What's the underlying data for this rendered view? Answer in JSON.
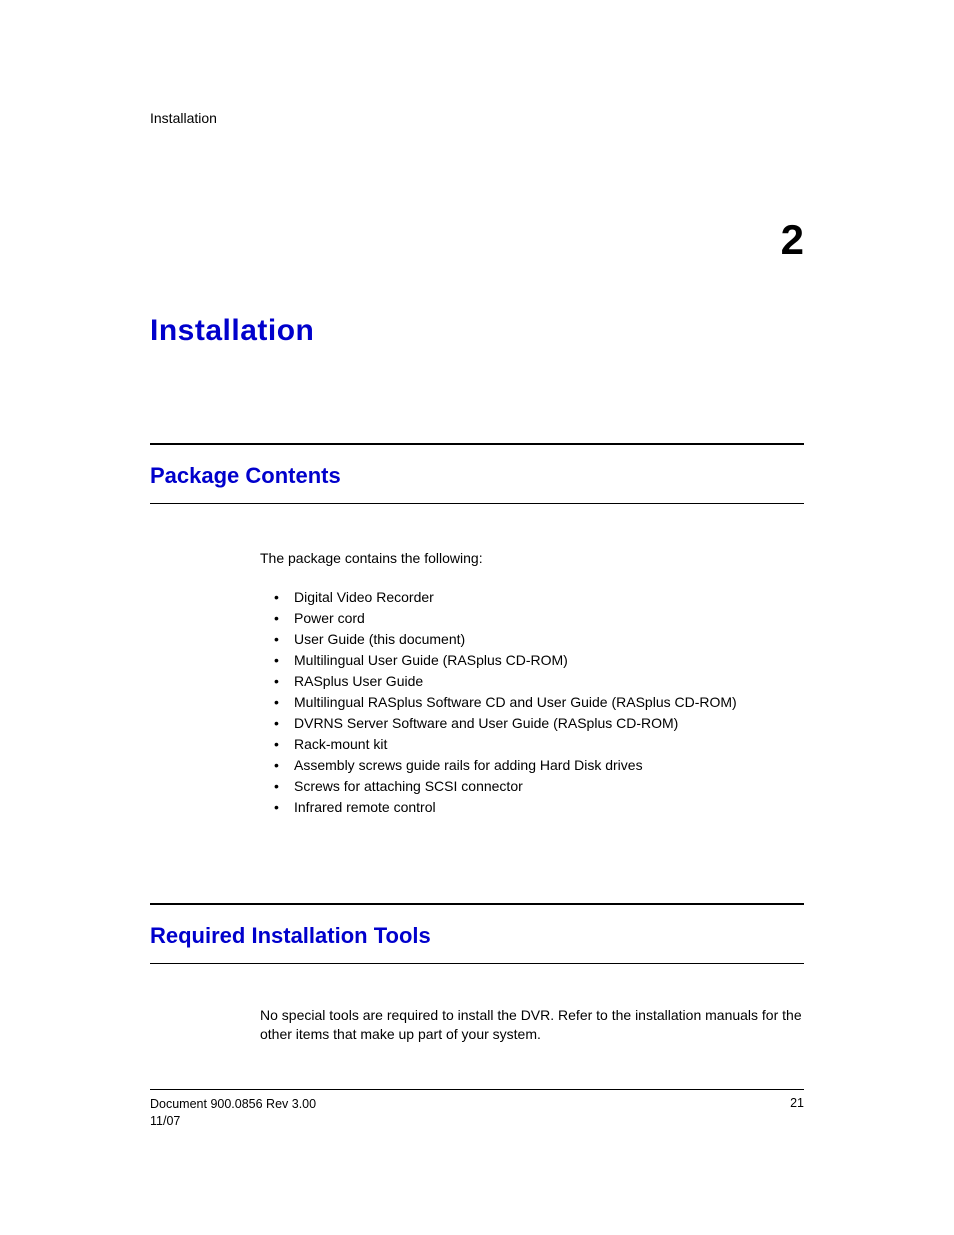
{
  "header": {
    "section_name": "Installation"
  },
  "chapter": {
    "number": "2",
    "title": "Installation"
  },
  "package_contents": {
    "title": "Package Contents",
    "intro": "The package contains the following:",
    "items": [
      "Digital Video Recorder",
      "Power cord",
      "User Guide (this document)",
      "Multilingual User Guide (RASplus CD-ROM)",
      "RASplus User Guide",
      "Multilingual RASplus Software CD and User Guide (RASplus CD-ROM)",
      "DVRNS Server Software and User Guide (RASplus CD-ROM)",
      "Rack-mount kit",
      "Assembly screws guide rails for adding Hard Disk drives",
      "Screws for attaching SCSI connector",
      "Infrared remote control"
    ]
  },
  "required_tools": {
    "title": "Required Installation Tools",
    "body": "No special tools are required to install the DVR. Refer to the installation manuals for the other items that make up part of your system."
  },
  "footer": {
    "doc_ref": "Document 900.0856 Rev 3.00",
    "date": "11/07",
    "page": "21"
  }
}
